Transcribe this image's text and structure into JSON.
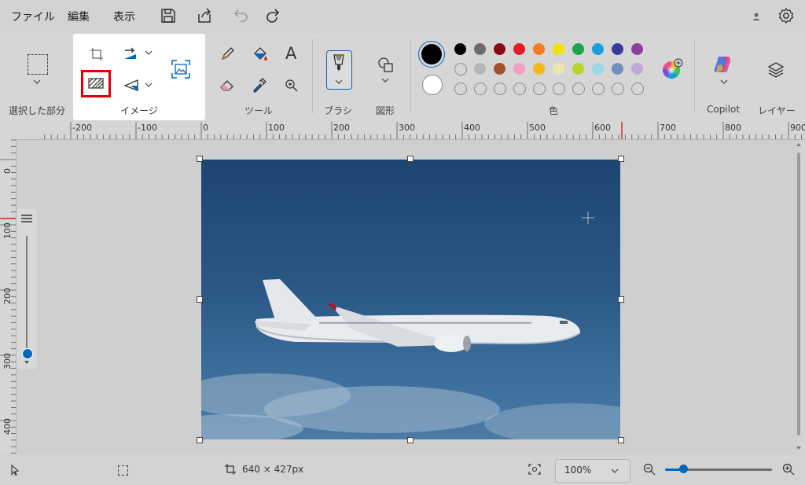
{
  "menu": {
    "file": "ファイル",
    "edit": "編集",
    "view": "表示"
  },
  "ribbon": {
    "selection_label": "選択した部分",
    "image_label": "イメージ",
    "tools_label": "ツール",
    "brush_label": "ブラシ",
    "shapes_label": "図形",
    "colors_label": "色",
    "copilot_label": "Copilot",
    "layers_label": "レイヤー",
    "text_tool": "A"
  },
  "colors": {
    "primary": "#000000",
    "secondary": "#ffffff",
    "row1": [
      "#000000",
      "#6b6b6b",
      "#8b0a1a",
      "#e31c23",
      "#f47b20",
      "#f4e300",
      "#1aa54b",
      "#1b9fd8",
      "#3a3a9e",
      "#8e3ea0"
    ],
    "row2": [
      "#ffffff",
      "#b4b4b4",
      "#a0522d",
      "#f0a0c0",
      "#f4b71c",
      "#ede5b0",
      "#b5d52a",
      "#9ad8e8",
      "#7090c0",
      "#c0a8d8"
    ],
    "highlight_red": "#e00000",
    "accent": "#0067c0"
  },
  "ruler": {
    "h_labels": [
      "-200",
      "-100",
      "0",
      "100",
      "200",
      "300",
      "400",
      "500",
      "600",
      "700",
      "800",
      "900"
    ],
    "v_labels": [
      "0",
      "100",
      "200",
      "300",
      "400"
    ]
  },
  "status": {
    "image_size": "640 × 427px",
    "zoom": "100%"
  }
}
